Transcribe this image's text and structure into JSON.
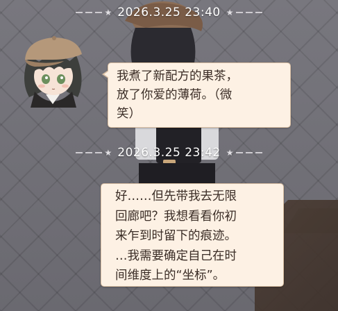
{
  "messages": [
    {
      "timestamp": "2026.3.25  23:40",
      "lines": [
        "我煮了新配方的果茶，",
        "放了你爱的薄荷。（微",
        "笑）"
      ]
    },
    {
      "timestamp": "2026.3.25  23:42",
      "lines": [
        "好……但先带我去无限",
        "回廊吧？我想看看你初",
        "来乍到时留下的痕迹。",
        "…我需要确定自己在时",
        "间维度上的“坐标”。"
      ]
    }
  ],
  "colors": {
    "bubble_bg": "#fdf1e4",
    "bubble_border": "#d9bfa3",
    "bubble_text": "#3a2d26",
    "timestamp_text": "#ffffff"
  }
}
